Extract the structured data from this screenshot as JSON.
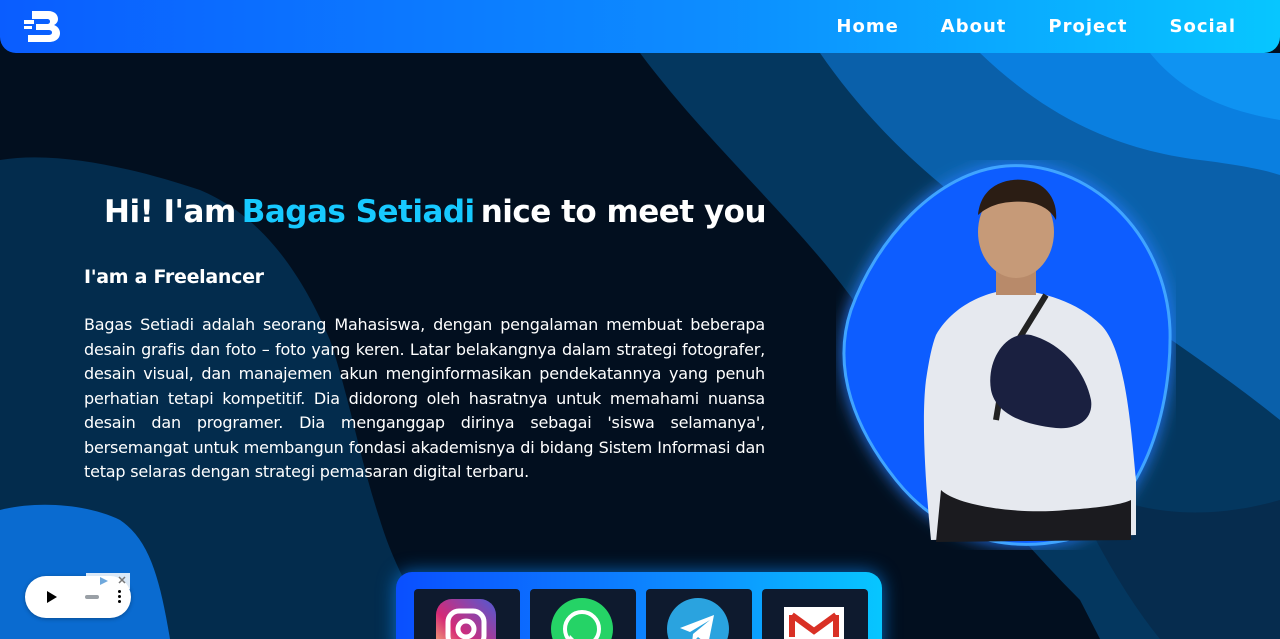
{
  "nav": {
    "logo_icon": "b-logo-icon",
    "links": [
      "Home",
      "About",
      "Project",
      "Social"
    ]
  },
  "hero": {
    "greeting": "Hi! I'am",
    "name": "Bagas Setiadi",
    "tail": "nice to meet you",
    "subtitle": "I'am a Freelancer",
    "bio": "Bagas Setiadi adalah seorang Mahasiswa, dengan pengalaman membuat beberapa desain grafis dan foto – foto yang keren. Latar belakangnya dalam strategi fotografer, desain visual, dan manajemen akun menginformasikan pendekatannya yang penuh perhatian tetapi kompetitif. Dia didorong oleh hasratnya untuk memahami nuansa desain dan programer. Dia menganggap dirinya sebagai 'siswa selamanya', bersemangat untuk membangun fondasi akademisnya di bidang Sistem Informasi dan tetap selaras dengan strategi pemasaran digital terbaru."
  },
  "social": {
    "items": [
      "instagram-icon",
      "whatsapp-icon",
      "telegram-icon",
      "gmail-icon"
    ]
  },
  "colors": {
    "accent": "#17c9ff",
    "nav_start": "#0a5dff",
    "nav_end": "#07c6ff",
    "background": "#020f1f"
  }
}
